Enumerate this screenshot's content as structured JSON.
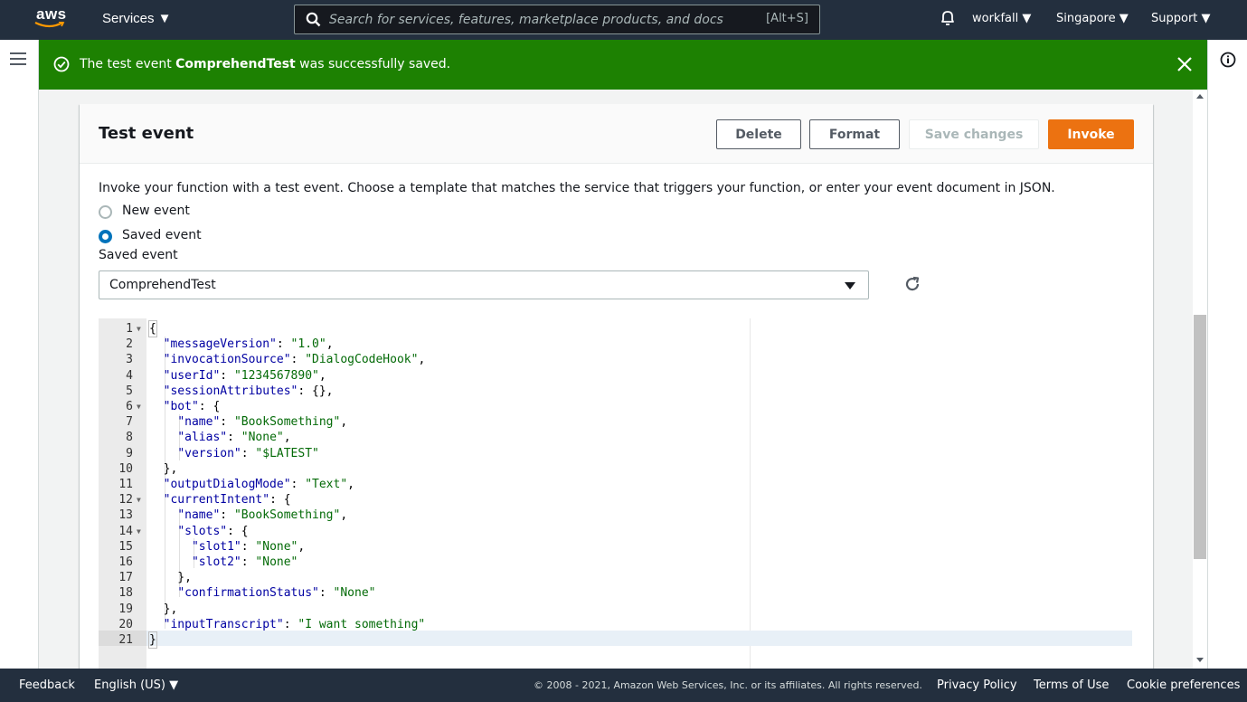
{
  "topnav": {
    "logo_text": "aws",
    "services_label": "Services ▼",
    "search_placeholder": "Search for services, features, marketplace products, and docs",
    "search_shortcut": "[Alt+S]",
    "account_label": "workfall ▼",
    "region_label": "Singapore ▼",
    "support_label": "Support ▼"
  },
  "flash": {
    "prefix": "The test event ",
    "event_name": "ComprehendTest",
    "suffix": " was successfully saved."
  },
  "panel": {
    "title": "Test event",
    "buttons": {
      "delete": "Delete",
      "format": "Format",
      "save": "Save changes",
      "invoke": "Invoke"
    },
    "description": "Invoke your function with a test event. Choose a template that matches the service that triggers your function, or enter your event document in JSON.",
    "radio_new": "New event",
    "radio_saved": "Saved event",
    "selected_radio": "saved",
    "saved_event_label": "Saved event",
    "saved_event_value": "ComprehendTest"
  },
  "editor": {
    "line_numbers": [
      "1",
      "2",
      "3",
      "4",
      "5",
      "6",
      "7",
      "8",
      "9",
      "10",
      "11",
      "12",
      "13",
      "14",
      "15",
      "16",
      "17",
      "18",
      "19",
      "20",
      "21"
    ],
    "fold_lines": [
      1,
      6,
      12,
      14
    ],
    "active_line": 21
  },
  "footer": {
    "feedback": "Feedback",
    "language": "English (US) ▼",
    "copyright": "© 2008 - 2021, Amazon Web Services, Inc. or its affiliates. All rights reserved.",
    "privacy": "Privacy Policy",
    "terms": "Terms of Use",
    "cookies": "Cookie preferences"
  },
  "colors": {
    "nav_bg": "#232f3e",
    "flash_success": "#1d8102",
    "primary_button": "#ec7211",
    "radio_selected": "#0073bb"
  }
}
